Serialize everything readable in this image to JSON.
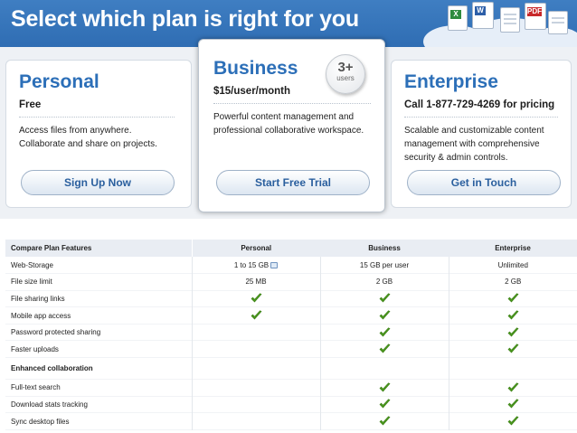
{
  "header": {
    "title": "Select which plan is right for you"
  },
  "plans": [
    {
      "name": "Personal",
      "price": "Free",
      "description_lines": [
        "Access files from anywhere.",
        "Collaborate and share on projects."
      ],
      "button": "Sign Up Now"
    },
    {
      "name": "Business",
      "price": "$15/user/month",
      "description_lines": [
        "Powerful content management and",
        "professional collaborative workspace."
      ],
      "button": "Start Free Trial",
      "badge": {
        "number": "3+",
        "unit": "users"
      }
    },
    {
      "name": "Enterprise",
      "price": "Call 1-877-729-4269 for pricing",
      "description_lines": [
        "Scalable and customizable content",
        "management with comprehensive",
        "security & admin controls."
      ],
      "button": "Get in Touch"
    }
  ],
  "table": {
    "columns": [
      "Compare Plan Features",
      "Personal",
      "Business",
      "Enterprise"
    ],
    "rows": [
      {
        "feature": "Web-Storage",
        "personal": "1 to 15 GB",
        "business": "15 GB per user",
        "enterprise": "Unlimited"
      },
      {
        "feature": "File size limit",
        "personal": "25 MB",
        "business": "2 GB",
        "enterprise": "2 GB"
      },
      {
        "feature": "File sharing links",
        "personal_check": true,
        "business_check": true,
        "enterprise_check": true
      },
      {
        "feature": "Mobile app access",
        "personal_check": true,
        "business_check": true,
        "enterprise_check": true
      },
      {
        "feature": "Password protected sharing",
        "business_check": true,
        "enterprise_check": true
      },
      {
        "feature": "Faster uploads",
        "business_check": true,
        "enterprise_check": true
      }
    ],
    "section_title": "Enhanced collaboration",
    "rows2": [
      {
        "feature": "Full-text search",
        "business_check": true,
        "enterprise_check": true
      },
      {
        "feature": "Download stats tracking",
        "business_check": true,
        "enterprise_check": true
      },
      {
        "feature": "Sync desktop files",
        "business_check": true,
        "enterprise_check": true
      }
    ]
  },
  "colors": {
    "header_blue": "#3377bd",
    "plan_title": "#2c6fb8",
    "button_text": "#2a5f9e",
    "check_green": "#4c9a1f"
  },
  "icons": [
    "excel-document-icon",
    "word-document-icon",
    "pdf-document-icon",
    "cloud-icon",
    "checkmark-icon",
    "info-icon"
  ]
}
